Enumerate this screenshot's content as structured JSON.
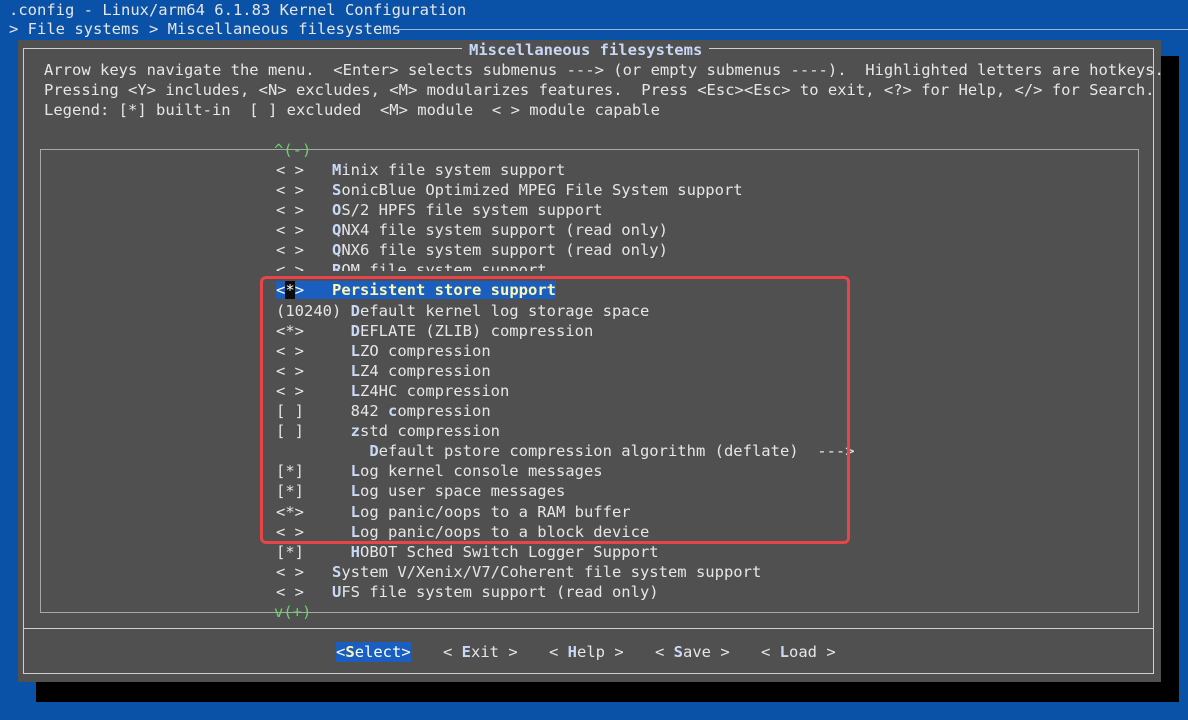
{
  "header": {
    "window_title": ".config - Linux/arm64 6.1.83 Kernel Configuration",
    "breadcrumb": "> File systems > Miscellaneous filesystems"
  },
  "dialog": {
    "title": "Miscellaneous filesystems",
    "help_lines": [
      "Arrow keys navigate the menu.  <Enter> selects submenus ---> (or empty submenus ----).  Highlighted letters are hotkeys.",
      "Pressing <Y> includes, <N> excludes, <M> modularizes features.  Press <Esc><Esc> to exit, <?> for Help, </> for Search.",
      "Legend: [*] built-in  [ ] excluded  <M> module  < > module capable"
    ],
    "scroll_up": "^(-)",
    "scroll_down": "v(+)"
  },
  "menu": {
    "items": [
      {
        "prefix": "< >   ",
        "hot": "M",
        "rest": "inix file system support"
      },
      {
        "prefix": "< >   ",
        "hot": "S",
        "rest": "onicBlue Optimized MPEG File System support"
      },
      {
        "prefix": "< >   ",
        "hot": "O",
        "rest": "S/2 HPFS file system support"
      },
      {
        "prefix": "< >   ",
        "hot": "Q",
        "rest": "NX4 file system support (read only)"
      },
      {
        "prefix": "< >   ",
        "hot": "Q",
        "rest": "NX6 file system support (read only)"
      },
      {
        "prefix": "< >   ",
        "hot": "R",
        "rest": "OM file system support"
      },
      {
        "prefix": "<",
        "mark": "*",
        "prefix2": ">   ",
        "hot": "P",
        "rest": "ersistent store support",
        "selected": true
      },
      {
        "prefix": "(10240) ",
        "hot": "D",
        "rest": "efault kernel log storage space"
      },
      {
        "prefix": "<*>     ",
        "hot": "D",
        "rest": "EFLATE (ZLIB) compression"
      },
      {
        "prefix": "< >     ",
        "hot": "L",
        "rest": "ZO compression"
      },
      {
        "prefix": "< >     ",
        "hot": "L",
        "rest": "Z4 compression"
      },
      {
        "prefix": "< >     ",
        "hot": "L",
        "rest": "Z4HC compression"
      },
      {
        "prefix": "[ ]     842 ",
        "hot": "c",
        "rest": "ompression"
      },
      {
        "prefix": "[ ]     ",
        "hot": "z",
        "rest": "std compression"
      },
      {
        "prefix": "          ",
        "hot": "D",
        "rest": "efault pstore compression algorithm (deflate)  --->"
      },
      {
        "prefix": "[*]     ",
        "hot": "L",
        "rest": "og kernel console messages"
      },
      {
        "prefix": "[*]     ",
        "hot": "L",
        "rest": "og user space messages"
      },
      {
        "prefix": "<*>     ",
        "hot": "L",
        "rest": "og panic/oops to a RAM buffer"
      },
      {
        "prefix": "< >     ",
        "hot": "L",
        "rest": "og panic/oops to a block device"
      },
      {
        "prefix": "[*]     ",
        "hot": "H",
        "rest": "OBOT Sched Switch Logger Support"
      },
      {
        "prefix": "< >   ",
        "hot": "S",
        "rest": "ystem V/Xenix/V7/Coherent file system support"
      },
      {
        "prefix": "< >   ",
        "hot": "U",
        "rest": "FS file system support (read only)"
      }
    ]
  },
  "buttons": [
    {
      "l": "<",
      "hot": "S",
      "rest": "elect",
      "r": ">"
    },
    {
      "l": "< ",
      "hot": "E",
      "rest": "xit",
      "r": " >"
    },
    {
      "l": "< ",
      "hot": "H",
      "rest": "elp",
      "r": " >"
    },
    {
      "l": "< ",
      "hot": "S",
      "rest": "ave",
      "r": " >"
    },
    {
      "l": "< ",
      "hot": "L",
      "rest": "oad",
      "r": " >"
    }
  ],
  "colors": {
    "background": "#0a52a8",
    "dialog": "#505050",
    "highlight": "#1a5fbf",
    "scroll_arrows": "#6ad36a",
    "annotation_box": "#e94448"
  }
}
